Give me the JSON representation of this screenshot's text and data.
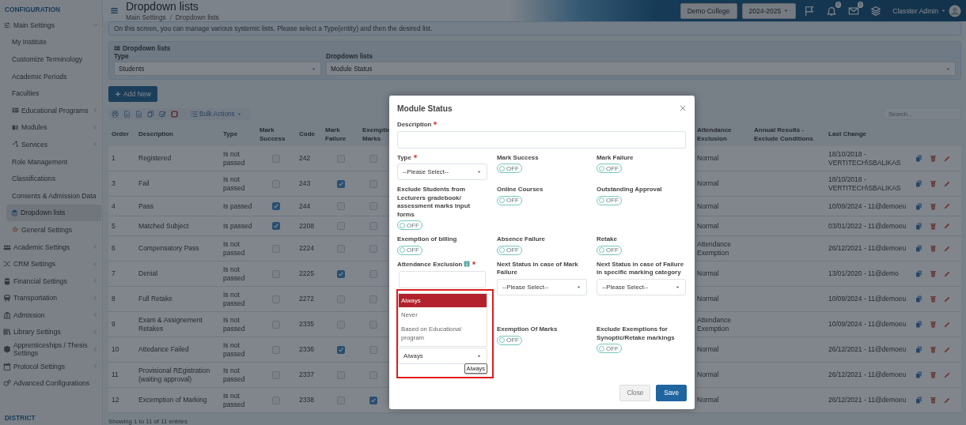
{
  "sidebar": {
    "sections": [
      {
        "title": "CONFIGURATION",
        "items": [
          {
            "label": "Main Settings",
            "selected": false,
            "expanded": true,
            "children": [
              {
                "label": "My Institute",
                "selected": false
              },
              {
                "label": "Customize Terminology",
                "selected": false
              },
              {
                "label": "Academic Periods",
                "selected": false
              },
              {
                "label": "Faculties",
                "selected": false
              },
              {
                "label": "Educational Programs",
                "selected": false,
                "expanded": false
              },
              {
                "label": "Modules",
                "selected": false,
                "expanded": false
              },
              {
                "label": "Services",
                "selected": false,
                "expanded": false
              },
              {
                "label": "Role Management",
                "selected": false
              },
              {
                "label": "Classifications",
                "selected": false
              },
              {
                "label": "Consents & Admission Data",
                "selected": false
              },
              {
                "label": "Dropdown lists",
                "selected": true
              },
              {
                "label": "General Settings",
                "selected": false
              }
            ]
          },
          {
            "label": "Academic Settings",
            "selected": false,
            "expanded": false
          },
          {
            "label": "CRM Settings",
            "selected": false,
            "expanded": false
          },
          {
            "label": "Financial Settings",
            "selected": false,
            "expanded": false
          },
          {
            "label": "Transportation",
            "selected": false,
            "expanded": false
          },
          {
            "label": "Admission",
            "selected": false,
            "expanded": false
          },
          {
            "label": "Library Settings",
            "selected": false,
            "expanded": false
          },
          {
            "label": "Apprenticeships / Thesis Settings",
            "selected": false,
            "expanded": false
          },
          {
            "label": "Protocol Settings",
            "selected": false,
            "expanded": false
          },
          {
            "label": "Advanced Configurations",
            "selected": false
          }
        ]
      },
      {
        "title": "DISTRICT"
      }
    ]
  },
  "header": {
    "title": "Dropdown lists",
    "breadcrumb": [
      "Main Settings",
      "Dropdown lists"
    ],
    "institution": "Demo College",
    "year": "2024-2025",
    "notifications": "0",
    "messages": "0",
    "user": "Classter Admin"
  },
  "info": "On this screen, you can manage various systemic lists. Please select a Type(entity) and then the desired list.",
  "filter_panel": {
    "title": "Dropdown lists",
    "fields": [
      {
        "label": "Type",
        "value": "Students"
      },
      {
        "label": "Dropdown lists",
        "value": "Module Status"
      }
    ]
  },
  "add_button": "Add New",
  "toolbar": {
    "bulk_actions": "Bulk Actions",
    "search_placeholder": "Search..."
  },
  "table": {
    "columns": [
      "Order",
      "Description",
      "Type",
      "Mark Success",
      "Code",
      "Mark Failure",
      "Exemptio Marks",
      "Attendance Exclusion",
      "Annual Results - Exclude Conditions",
      "Last Change"
    ],
    "rows": [
      {
        "order": "1",
        "description": "Registered",
        "type": "Is not passed",
        "mark_success": false,
        "code": "242",
        "mark_failure": false,
        "exemption_marks": false,
        "attendance_exclusion": "Normal",
        "last_change": "18/10/2018 - VERTITECH\\SBALIKAS"
      },
      {
        "order": "3",
        "description": "Fail",
        "type": "Is not passed",
        "mark_success": false,
        "code": "243",
        "mark_failure": true,
        "exemption_marks": false,
        "attendance_exclusion": "Normal",
        "last_change": "18/10/2018 - VERTITECH\\SBALIKAS"
      },
      {
        "order": "4",
        "description": "Pass",
        "type": "Is passed",
        "mark_success": true,
        "code": "244",
        "mark_failure": false,
        "exemption_marks": false,
        "attendance_exclusion": "Normal",
        "last_change": "10/09/2024 - 11@demoeu"
      },
      {
        "order": "5",
        "description": "Matched Subject",
        "type": "Is passed",
        "mark_success": true,
        "code": "2208",
        "mark_failure": false,
        "exemption_marks": false,
        "attendance_exclusion": "Normal",
        "last_change": "03/01/2022 - 11@demoeu"
      },
      {
        "order": "6",
        "description": "Compensatory Pass",
        "type": "Is not passed",
        "mark_success": false,
        "code": "2224",
        "mark_failure": false,
        "exemption_marks": false,
        "attendance_exclusion": "Attendance Exemption",
        "last_change": "26/12/2021 - 11@demoeu"
      },
      {
        "order": "7",
        "description": "Denial",
        "type": "Is not passed",
        "mark_success": false,
        "code": "2225",
        "mark_failure": true,
        "exemption_marks": false,
        "attendance_exclusion": "Normal",
        "last_change": "13/01/2020 - 11@demo"
      },
      {
        "order": "8",
        "description": "Full Retake",
        "type": "Is not passed",
        "mark_success": false,
        "code": "2272",
        "mark_failure": false,
        "exemption_marks": false,
        "attendance_exclusion": "Normal",
        "last_change": "10/09/2024 - 11@demoeu"
      },
      {
        "order": "9",
        "description": "Exam & Assignement Retakes",
        "type": "Is not passed",
        "mark_success": false,
        "code": "2335",
        "mark_failure": false,
        "exemption_marks": false,
        "attendance_exclusion": "Attendance Exemption",
        "last_change": "10/09/2024 - 11@demoeu"
      },
      {
        "order": "10",
        "description": "Attedance Failed",
        "type": "Is not passed",
        "mark_success": false,
        "code": "2336",
        "mark_failure": true,
        "exemption_marks": false,
        "attendance_exclusion": "Normal",
        "last_change": "26/12/2021 - 11@demoeu"
      },
      {
        "order": "11",
        "description": "Provisional REgistration (waiting approval)",
        "type": "Is not passed",
        "mark_success": false,
        "code": "2337",
        "mark_failure": false,
        "exemption_marks": false,
        "attendance_exclusion": "Normal",
        "last_change": "26/12/2021 - 11@demoeu"
      },
      {
        "order": "12",
        "description": "Excemption of Marking",
        "type": "Is not passed",
        "mark_success": false,
        "code": "2338",
        "mark_failure": false,
        "exemption_marks": true,
        "attendance_exclusion": "Normal",
        "last_change": "26/12/2021 - 11@demoeu"
      }
    ],
    "footer": "Showing 1 to 11 of 11 entries"
  },
  "modal": {
    "title": "Module Status",
    "fields": [
      {
        "kind": "text",
        "label": "Description",
        "required": true
      },
      {
        "kind": "select",
        "label": "Type",
        "required": true,
        "value": "--Please Select--"
      },
      {
        "kind": "toggle",
        "label": "Mark Success",
        "on": false,
        "state_text": "OFF"
      },
      {
        "kind": "toggle",
        "label": "Mark Failure",
        "on": false,
        "state_text": "OFF"
      },
      {
        "kind": "toggle",
        "label": "Exclude Students from Lecturers gradebook/ assessment marks input forms",
        "on": false,
        "state_text": "OFF"
      },
      {
        "kind": "toggle",
        "label": "Online Courses",
        "on": false,
        "state_text": "OFF"
      },
      {
        "kind": "toggle",
        "label": "Outstanding Approval",
        "on": false,
        "state_text": "OFF"
      },
      {
        "kind": "toggle",
        "label": "Exemption of billing",
        "on": false,
        "state_text": "OFF"
      },
      {
        "kind": "toggle",
        "label": "Absence Failure",
        "on": false,
        "state_text": "OFF"
      },
      {
        "kind": "toggle",
        "label": "Retake",
        "on": false,
        "state_text": "OFF"
      },
      {
        "kind": "select",
        "label": "Attendance Exclusion",
        "required": true,
        "info": true,
        "value": "Always",
        "open": true,
        "highlighted": true,
        "tooltip": "Always",
        "options": [
          {
            "label": "Always",
            "selected": true
          },
          {
            "label": "Never",
            "selected": false
          },
          {
            "label": "Based on Educational program",
            "selected": false
          }
        ]
      },
      {
        "kind": "select",
        "label": "Next Status in case of Mark Failure",
        "required": false,
        "value": "--Please Select--"
      },
      {
        "kind": "select",
        "label": "Next Status in case of Failure in specific marking category",
        "required": false,
        "value": "--Please Select--"
      },
      {
        "kind": "toggle",
        "label": "Exemption Of Marks",
        "on": false,
        "state_text": "OFF"
      },
      {
        "kind": "toggle",
        "label": "Exclude Exemptions for Synoptic/Retake markings",
        "on": false,
        "state_text": "OFF"
      }
    ],
    "buttons": [
      {
        "label": "Close",
        "kind": "secondary"
      },
      {
        "label": "Save",
        "kind": "primary"
      }
    ]
  }
}
